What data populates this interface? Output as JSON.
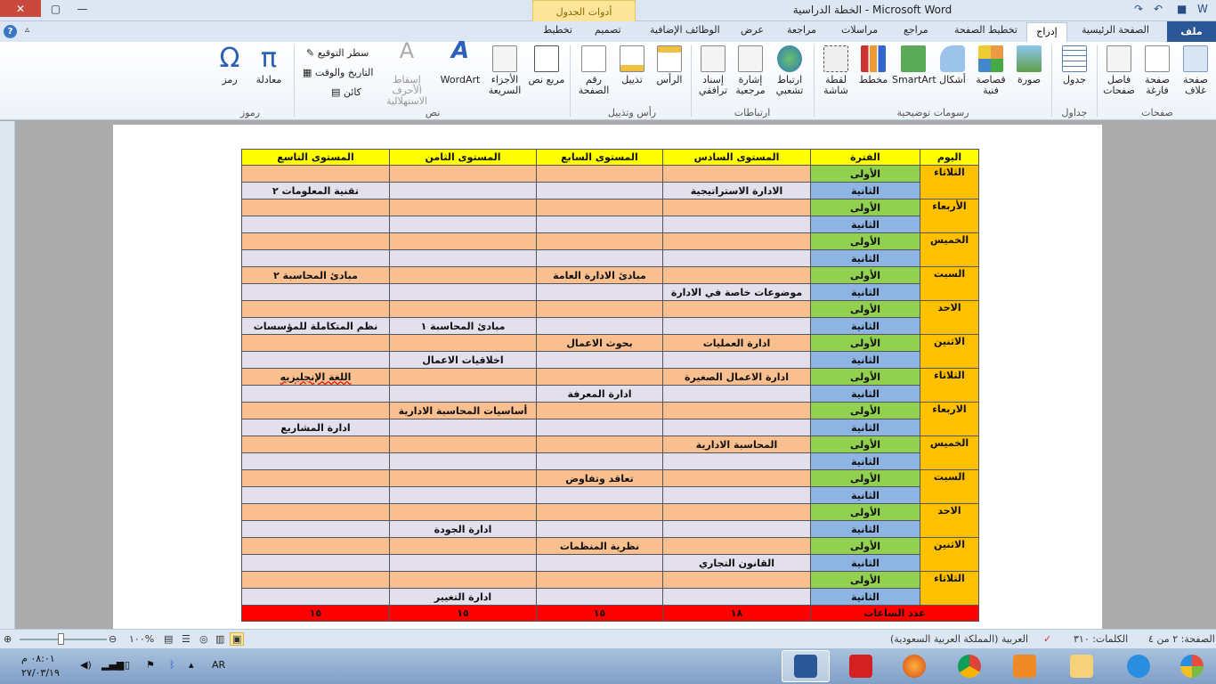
{
  "window": {
    "title": "الخطة الدراسية  -  Microsoft Word",
    "contextual_group": "أدوات الجدول",
    "close_glyph": "✕",
    "max_glyph": "▢",
    "min_glyph": "—"
  },
  "tabs": {
    "file": "ملف",
    "home": "الصفحة الرئيسية",
    "insert": "إدراج",
    "page_layout": "تخطيط الصفحة",
    "references": "مراجع",
    "mailings": "مراسلات",
    "review": "مراجعة",
    "view": "عرض",
    "addins": "الوظائف الإضافية",
    "design": "تصميم",
    "layout": "تخطيط"
  },
  "ribbon": {
    "pages": {
      "cover": "صفحة غلاف",
      "blank": "صفحة فارغة",
      "break": "فاصل صفحات",
      "label": "صفحات"
    },
    "tables": {
      "table": "جدول",
      "label": "جداول"
    },
    "illustrations": {
      "picture": "صورة",
      "clipart": "قصاصة فنية",
      "shapes": "أشكال",
      "smartart": "SmartArt",
      "chart": "مخطط",
      "screenshot": "لقطة شاشة",
      "label": "رسومات توضيحية"
    },
    "links": {
      "hyperlink": "ارتباط تشعبي",
      "bookmark": "إشارة مرجعية",
      "crossref": "إسناد ترافقي",
      "label": "ارتباطات"
    },
    "header_footer": {
      "header": "الرأس",
      "footer": "تذييل",
      "page_number": "رقم الصفحة",
      "label": "رأس وتذييل"
    },
    "text": {
      "textbox": "مربع نص",
      "quickparts": "الأجزاء السريعة",
      "wordart": "WordArt",
      "dropcap": "إسقاط الأحرف الاستهلالية",
      "signature": "سطر التوقيع",
      "datetime": "التاريخ والوقت",
      "object": "كائن",
      "label": "نص"
    },
    "symbols": {
      "equation": "معادلة",
      "symbol": "رمز",
      "label": "رموز"
    }
  },
  "table": {
    "headers": [
      "اليوم",
      "الفترة",
      "المستوى السادس",
      "المستوى السابع",
      "المستوى الثامن",
      "المستوى التاسع"
    ],
    "days": [
      {
        "day": "الثلاثاء",
        "rows": [
          [
            "",
            "",
            "",
            ""
          ],
          [
            "الادارة الاستراتيجية",
            "",
            "",
            "تقنية المعلومات ٢"
          ]
        ]
      },
      {
        "day": "الأربعاء",
        "rows": [
          [
            "",
            "",
            "",
            ""
          ],
          [
            "",
            "",
            "",
            ""
          ]
        ]
      },
      {
        "day": "الخميس",
        "rows": [
          [
            "",
            "",
            "",
            ""
          ],
          [
            "",
            "",
            "",
            ""
          ]
        ]
      },
      {
        "day": "السبت",
        "rows": [
          [
            "",
            "مبادئ الادارة العامة",
            "",
            "مبادئ المحاسبة ٢"
          ],
          [
            "موضوعات خاصة في الادارة",
            "",
            "",
            ""
          ]
        ]
      },
      {
        "day": "الاحد",
        "rows": [
          [
            "",
            "",
            "",
            ""
          ],
          [
            "",
            "",
            "مبادئ المحاسبة ١",
            "نظم المتكاملة للمؤسسات"
          ]
        ]
      },
      {
        "day": "الاثنين",
        "rows": [
          [
            "ادارة العمليات",
            "بحوث الاعمال",
            "",
            ""
          ],
          [
            "",
            "",
            "اخلاقيات الاعمال",
            ""
          ]
        ]
      },
      {
        "day": "الثلاثاء",
        "rows": [
          [
            "ادارة الاعمال الصغيرة",
            "",
            "",
            "اللغة الإنجليزيه"
          ],
          [
            "",
            "ادارة المعرفة",
            "",
            ""
          ]
        ]
      },
      {
        "day": "الاربعاء",
        "rows": [
          [
            "",
            "",
            "أساسيات المحاسبة الادارية",
            ""
          ],
          [
            "",
            "",
            "",
            "ادارة المشاريع"
          ]
        ]
      },
      {
        "day": "الخميس",
        "rows": [
          [
            "المحاسبة الادارية",
            "",
            "",
            ""
          ],
          [
            "",
            "",
            "",
            ""
          ]
        ]
      },
      {
        "day": "السبت",
        "rows": [
          [
            "",
            "تعاقد وتفاوض",
            "",
            ""
          ],
          [
            "",
            "",
            "",
            ""
          ]
        ]
      },
      {
        "day": "الاحد",
        "rows": [
          [
            "",
            "",
            "",
            ""
          ],
          [
            "",
            "",
            "ادارة الجودة",
            ""
          ]
        ]
      },
      {
        "day": "الاثنين",
        "rows": [
          [
            "",
            "نظرية المنظمات",
            "",
            ""
          ],
          [
            "القانون التجاري",
            "",
            "",
            ""
          ]
        ]
      },
      {
        "day": "الثلاثاء",
        "rows": [
          [
            "",
            "",
            "",
            ""
          ],
          [
            "",
            "",
            "ادارة التغيير",
            ""
          ]
        ]
      }
    ],
    "period1": "الأولى",
    "period2": "الثانية",
    "total_label": "عدد الساعات",
    "totals": [
      "١٨",
      "١٥",
      "١٥",
      "١٥"
    ]
  },
  "statusbar": {
    "page": "الصفحة: ٢ من ٤",
    "words": "الكلمات: ٣١٠",
    "language": "العربية (المملكة العربية السعودية)",
    "zoom": "١٠٠%"
  },
  "taskbar": {
    "time": "٠٨:٠١ م",
    "date": "٢٧/٠٣/١٩",
    "lang": "AR"
  },
  "colors": {
    "header": "#ffff00",
    "day": "#ffc000",
    "period1": "#92d050",
    "period2": "#8db4e2",
    "row1": "#fabf8f",
    "row2": "#e4dfec",
    "total": "#ff0000"
  }
}
